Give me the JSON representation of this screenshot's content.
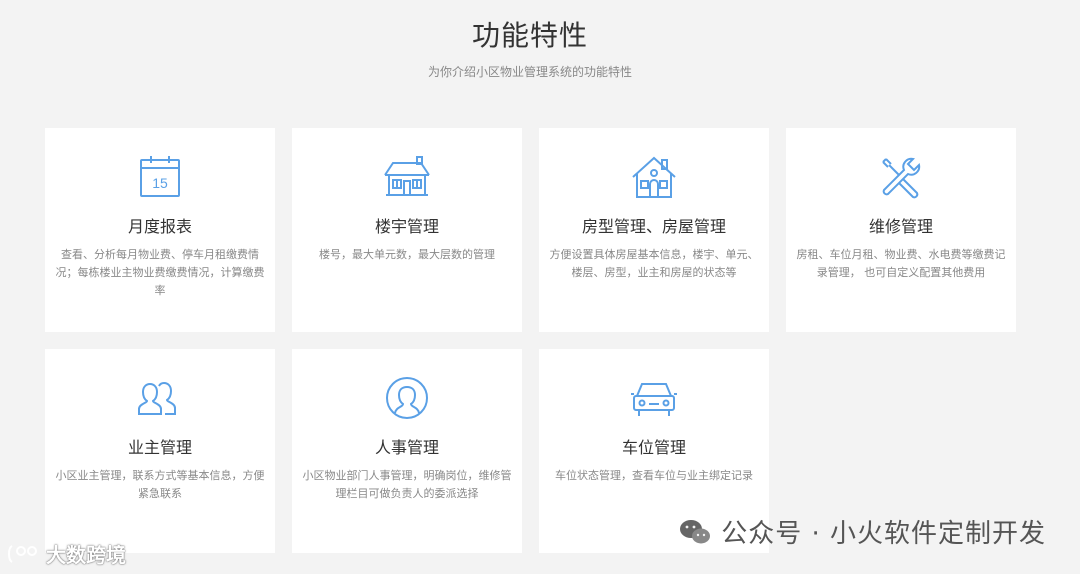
{
  "header": {
    "title": "功能特性",
    "subtitle": "为你介绍小区物业管理系统的功能特性"
  },
  "colors": {
    "icon": "#5aa0e6",
    "background": "#f3f3f3",
    "card": "#ffffff"
  },
  "features": [
    {
      "icon": "calendar-icon",
      "day": "15",
      "title": "月度报表",
      "desc": "查看、分析每月物业费、停车月租缴费情况；每栋楼业主物业费缴费情况，计算缴费率"
    },
    {
      "icon": "building-icon",
      "title": "楼宇管理",
      "desc": "楼号，最大单元数，最大层数的管理"
    },
    {
      "icon": "house-icon",
      "title": "房型管理、房屋管理",
      "desc": "方便设置具体房屋基本信息，楼宇、单元、楼层、房型，业主和房屋的状态等"
    },
    {
      "icon": "wrench-screwdriver-icon",
      "title": "维修管理",
      "desc": "房租、车位月租、物业费、水电费等缴费记录管理， 也可自定义配置其他费用"
    },
    {
      "icon": "users-icon",
      "title": "业主管理",
      "desc": "小区业主管理，联系方式等基本信息，方便紧急联系"
    },
    {
      "icon": "user-circle-icon",
      "title": "人事管理",
      "desc": "小区物业部门人事管理，明确岗位，维修管理栏目可做负责人的委派选择"
    },
    {
      "icon": "car-icon",
      "title": "车位管理",
      "desc": "车位状态管理，查看车位与业主绑定记录"
    }
  ],
  "watermarks": {
    "left": "大数跨境",
    "right": "公众号 · 小火软件定制开发"
  }
}
